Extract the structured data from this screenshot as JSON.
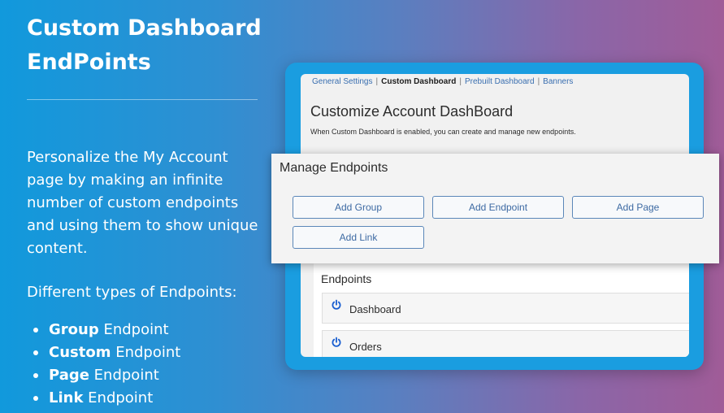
{
  "hero": {
    "title": "Custom Dashboard EndPoints",
    "description": "Personalize the My Account page by making an infinite number of custom endpoints and using them to show unique content.",
    "types_heading": "Different types of Endpoints:",
    "types": [
      {
        "bold": "Group",
        "rest": " Endpoint"
      },
      {
        "bold": "Custom",
        "rest": " Endpoint"
      },
      {
        "bold": "Page",
        "rest": " Endpoint"
      },
      {
        "bold": "Link",
        "rest": " Endpoint"
      }
    ]
  },
  "settings": {
    "tabs": [
      "General Settings",
      "Custom Dashboard",
      "Prebuilt Dashboard",
      "Banners"
    ],
    "active_tab": "Custom Dashboard",
    "title": "Customize Account DashBoard",
    "subtitle": "When Custom Dashboard is enabled, you can create and manage new endpoints."
  },
  "manage": {
    "title": "Manage Endpoints",
    "buttons": {
      "add_group": "Add Group",
      "add_endpoint": "Add Endpoint",
      "add_page": "Add Page",
      "add_link": "Add Link"
    }
  },
  "endpoints": {
    "label": "Endpoints",
    "items": [
      "Dashboard",
      "Orders"
    ]
  },
  "colors": {
    "accent": "#1a9de0",
    "link": "#3a6fb0",
    "power_icon": "#1a5fd0"
  }
}
